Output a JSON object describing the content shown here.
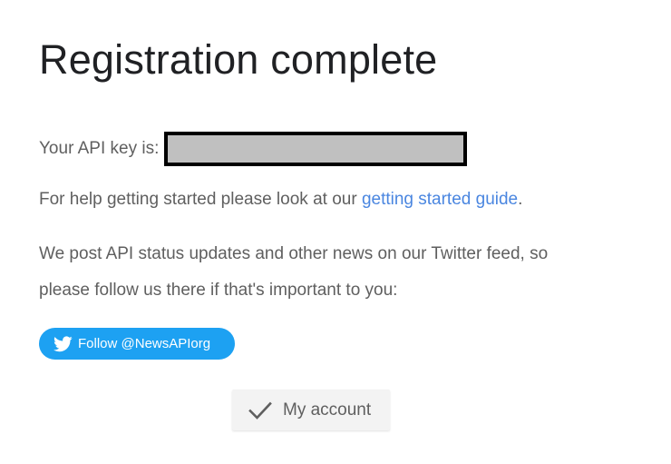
{
  "page": {
    "title": "Registration complete"
  },
  "api_key": {
    "label": "Your API key is:",
    "value_redacted": true
  },
  "help": {
    "prefix": "For help getting started please look at our ",
    "link_text": "getting started guide",
    "suffix": "."
  },
  "news": {
    "line1": "We post API status updates and other news on our Twitter feed, so",
    "line2": "please follow us there if that's important to you:"
  },
  "twitter_button": {
    "label": "Follow @NewsAPIorg",
    "icon": "twitter-bird-icon",
    "color": "#1da1f2"
  },
  "account_button": {
    "label": "My account",
    "icon": "checkmark-icon"
  },
  "colors": {
    "link": "#4a86e0",
    "text": "#5f5f5f",
    "title": "#202124",
    "redaction": "#c0c0c0"
  }
}
